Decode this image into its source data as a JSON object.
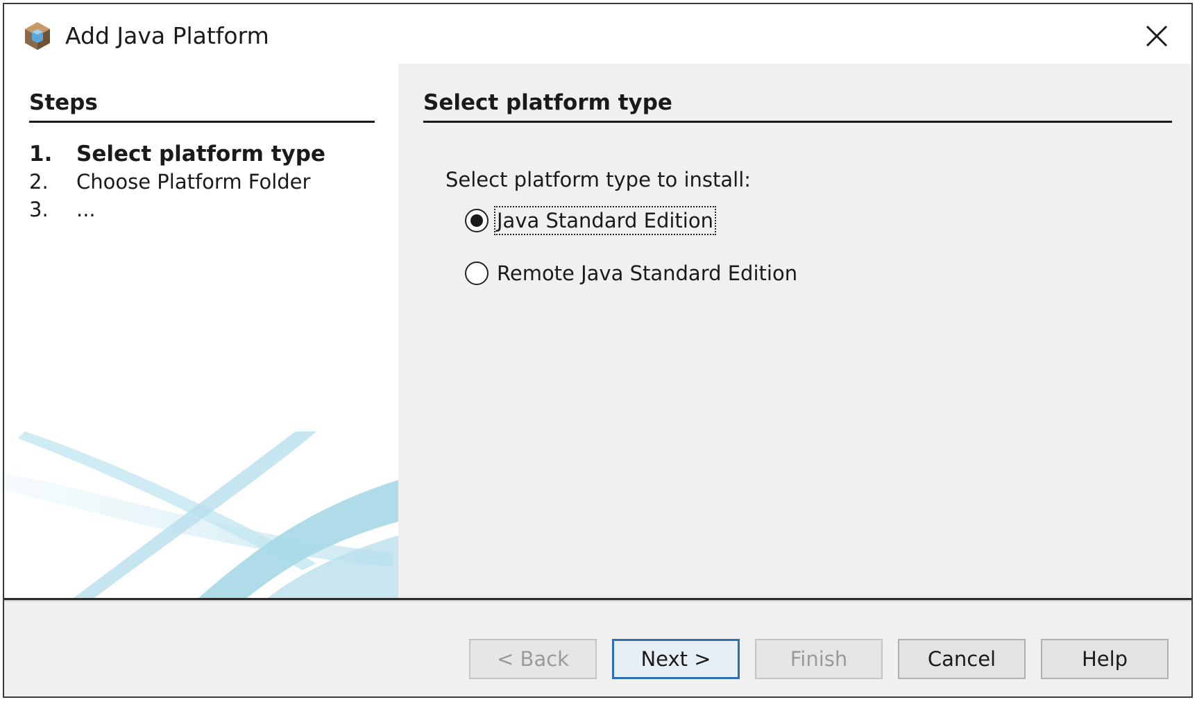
{
  "window": {
    "title": "Add Java Platform",
    "icon": "netbeans-cube-icon",
    "close": "close-icon"
  },
  "steps": {
    "heading": "Steps",
    "items": [
      {
        "num": "1.",
        "label": "Select platform type",
        "current": true
      },
      {
        "num": "2.",
        "label": "Choose Platform Folder",
        "current": false
      },
      {
        "num": "3.",
        "label": "...",
        "current": false
      }
    ]
  },
  "main": {
    "heading": "Select platform type",
    "prompt": "Select platform type to install:",
    "options": [
      {
        "label": "Java Standard Edition",
        "selected": true
      },
      {
        "label": "Remote Java Standard Edition",
        "selected": false
      }
    ]
  },
  "buttons": {
    "back": "< Back",
    "next": "Next >",
    "finish": "Finish",
    "cancel": "Cancel",
    "help": "Help"
  },
  "colors": {
    "accent": "#2f6fb4",
    "panel": "#f0f0f0",
    "decor": "#bfe3ee"
  }
}
